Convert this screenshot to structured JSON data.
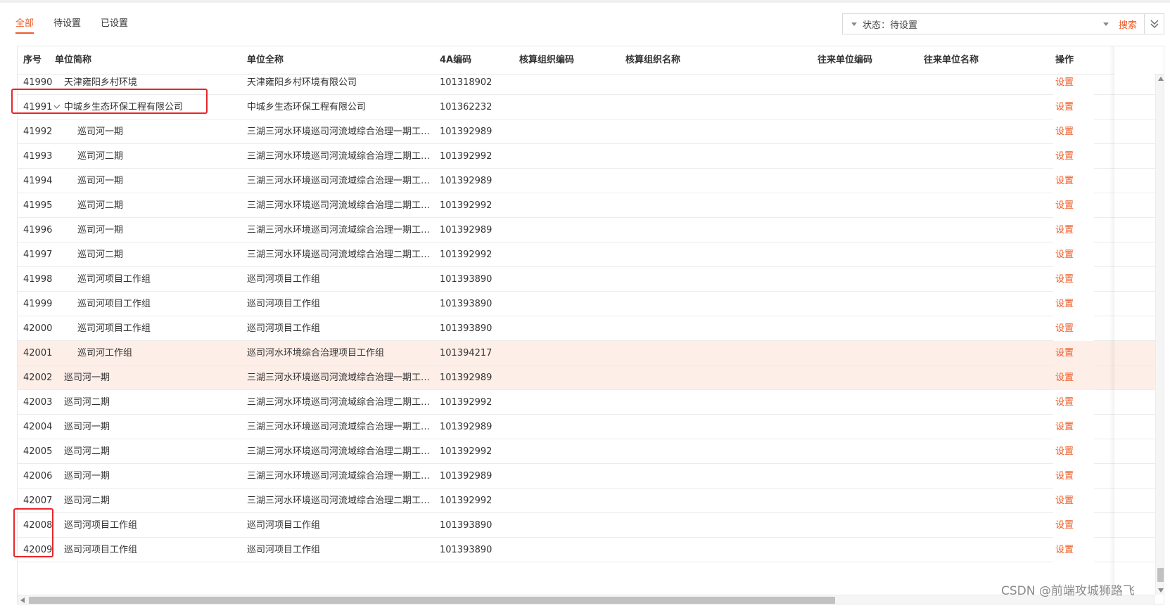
{
  "tabs": [
    {
      "label": "全部",
      "active": true
    },
    {
      "label": "待设置",
      "active": false
    },
    {
      "label": "已设置",
      "active": false
    }
  ],
  "search": {
    "filter_text": "状态：待设置",
    "button_label": "搜索",
    "collapse_icon": "double-chevron-down-icon"
  },
  "table": {
    "columns": [
      "序号",
      "单位简称",
      "单位全称",
      "4A编码",
      "核算组织编码",
      "核算组织名称",
      "往来单位编码",
      "往来单位名称",
      "操作"
    ],
    "rows": [
      {
        "idx": "41990",
        "short": "天津雍阳乡村环境",
        "full": "天津雍阳乡村环境有限公司",
        "code": "101318902",
        "op": "设置",
        "level": 0,
        "expanded": false,
        "highlight": false
      },
      {
        "idx": "41991",
        "short": "中城乡生态环保工程有限公司",
        "full": "中城乡生态环保工程有限公司",
        "code": "101362232",
        "op": "设置",
        "level": 0,
        "expanded": true,
        "highlight": false
      },
      {
        "idx": "41992",
        "short": "巡司河一期",
        "full": "三湖三河水环境巡司河流域综合治理一期工程...",
        "code": "101392989",
        "op": "设置",
        "level": 1,
        "expanded": false,
        "highlight": false
      },
      {
        "idx": "41993",
        "short": "巡司河二期",
        "full": "三湖三河水环境巡司河流域综合治理二期工程...",
        "code": "101392992",
        "op": "设置",
        "level": 1,
        "expanded": false,
        "highlight": false
      },
      {
        "idx": "41994",
        "short": "巡司河一期",
        "full": "三湖三河水环境巡司河流域综合治理一期工程...",
        "code": "101392989",
        "op": "设置",
        "level": 1,
        "expanded": false,
        "highlight": false
      },
      {
        "idx": "41995",
        "short": "巡司河二期",
        "full": "三湖三河水环境巡司河流域综合治理二期工程...",
        "code": "101392992",
        "op": "设置",
        "level": 1,
        "expanded": false,
        "highlight": false
      },
      {
        "idx": "41996",
        "short": "巡司河一期",
        "full": "三湖三河水环境巡司河流域综合治理一期工程...",
        "code": "101392989",
        "op": "设置",
        "level": 1,
        "expanded": false,
        "highlight": false
      },
      {
        "idx": "41997",
        "short": "巡司河二期",
        "full": "三湖三河水环境巡司河流域综合治理二期工程...",
        "code": "101392992",
        "op": "设置",
        "level": 1,
        "expanded": false,
        "highlight": false
      },
      {
        "idx": "41998",
        "short": "巡司河项目工作组",
        "full": "巡司河项目工作组",
        "code": "101393890",
        "op": "设置",
        "level": 1,
        "expanded": false,
        "highlight": false
      },
      {
        "idx": "41999",
        "short": "巡司河项目工作组",
        "full": "巡司河项目工作组",
        "code": "101393890",
        "op": "设置",
        "level": 1,
        "expanded": false,
        "highlight": false
      },
      {
        "idx": "42000",
        "short": "巡司河项目工作组",
        "full": "巡司河项目工作组",
        "code": "101393890",
        "op": "设置",
        "level": 1,
        "expanded": false,
        "highlight": false
      },
      {
        "idx": "42001",
        "short": "巡司河工作组",
        "full": "巡司河水环境综合治理项目工作组",
        "code": "101394217",
        "op": "设置",
        "level": 1,
        "expanded": false,
        "highlight": true
      },
      {
        "idx": "42002",
        "short": "巡司河一期",
        "full": "三湖三河水环境巡司河流域综合治理一期工程...",
        "code": "101392989",
        "op": "设置",
        "level": 0,
        "expanded": false,
        "highlight": true
      },
      {
        "idx": "42003",
        "short": "巡司河二期",
        "full": "三湖三河水环境巡司河流域综合治理二期工程...",
        "code": "101392992",
        "op": "设置",
        "level": 0,
        "expanded": false,
        "highlight": false
      },
      {
        "idx": "42004",
        "short": "巡司河一期",
        "full": "三湖三河水环境巡司河流域综合治理一期工程...",
        "code": "101392989",
        "op": "设置",
        "level": 0,
        "expanded": false,
        "highlight": false
      },
      {
        "idx": "42005",
        "short": "巡司河二期",
        "full": "三湖三河水环境巡司河流域综合治理二期工程...",
        "code": "101392992",
        "op": "设置",
        "level": 0,
        "expanded": false,
        "highlight": false
      },
      {
        "idx": "42006",
        "short": "巡司河一期",
        "full": "三湖三河水环境巡司河流域综合治理一期工程...",
        "code": "101392989",
        "op": "设置",
        "level": 0,
        "expanded": false,
        "highlight": false
      },
      {
        "idx": "42007",
        "short": "巡司河二期",
        "full": "三湖三河水环境巡司河流域综合治理二期工程...",
        "code": "101392992",
        "op": "设置",
        "level": 0,
        "expanded": false,
        "highlight": false
      },
      {
        "idx": "42008",
        "short": "巡司河项目工作组",
        "full": "巡司河项目工作组",
        "code": "101393890",
        "op": "设置",
        "level": 0,
        "expanded": false,
        "highlight": false
      },
      {
        "idx": "42009",
        "short": "巡司河项目工作组",
        "full": "巡司河项目工作组",
        "code": "101393890",
        "op": "设置",
        "level": 0,
        "expanded": false,
        "highlight": false
      }
    ]
  },
  "watermark": "CSDN @前端攻城狮路飞",
  "colors": {
    "accent": "#ee5a24",
    "highlight_row": "#fdeee8",
    "annotation": "#e8262a"
  }
}
